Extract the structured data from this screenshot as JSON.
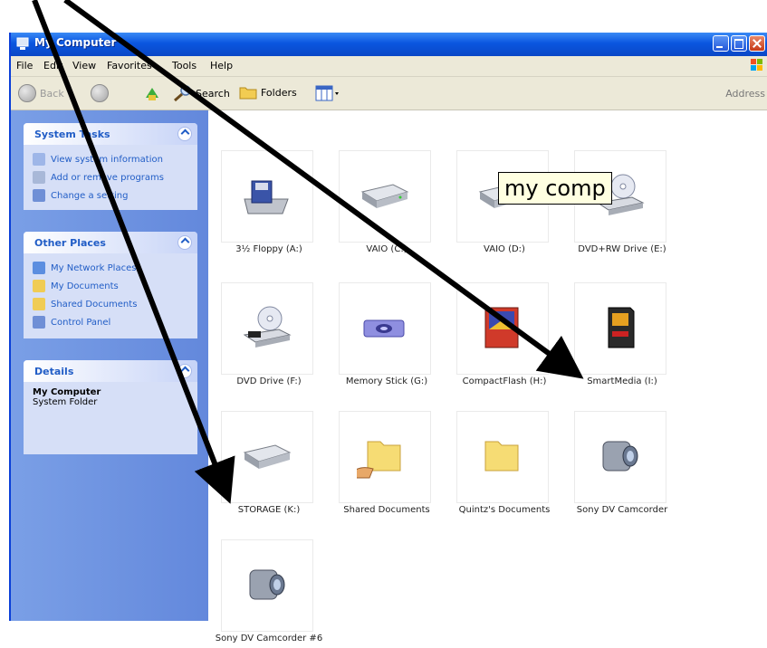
{
  "window": {
    "title": "My Computer",
    "menu": [
      "File",
      "Edit",
      "View",
      "Favorites",
      "Tools",
      "Help"
    ]
  },
  "toolbar": {
    "back_label": "Back",
    "search_label": "Search",
    "folders_label": "Folders",
    "address_label": "Address"
  },
  "sidebar": {
    "system_tasks": {
      "title": "System Tasks",
      "items": [
        "View system information",
        "Add or remove programs",
        "Change a setting"
      ]
    },
    "other_places": {
      "title": "Other Places",
      "items": [
        "My Network Places",
        "My Documents",
        "Shared Documents",
        "Control Panel"
      ]
    },
    "details": {
      "title": "Details",
      "name": "My Computer",
      "subtitle": "System Folder"
    }
  },
  "items": [
    {
      "label": "3½ Floppy (A:)",
      "icon": "floppy-drive-icon"
    },
    {
      "label": "VAIO (C:)",
      "icon": "hard-drive-icon"
    },
    {
      "label": "VAIO (D:)",
      "icon": "hard-drive-icon"
    },
    {
      "label": "DVD+RW Drive (E:)",
      "icon": "dvd-drive-icon"
    },
    {
      "label": "DVD Drive (F:)",
      "icon": "dvd-drive-icon"
    },
    {
      "label": "Memory Stick (G:)",
      "icon": "memory-stick-icon"
    },
    {
      "label": "CompactFlash (H:)",
      "icon": "compactflash-icon"
    },
    {
      "label": "SmartMedia (I:)",
      "icon": "smartmedia-icon"
    },
    {
      "label": "STORAGE (K:)",
      "icon": "hard-drive-icon"
    },
    {
      "label": "Shared Documents",
      "icon": "shared-folder-icon"
    },
    {
      "label": "Quintz's Documents",
      "icon": "folder-icon"
    },
    {
      "label": "Sony DV Camcorder",
      "icon": "camcorder-icon"
    },
    {
      "label": "Sony DV Camcorder #6",
      "icon": "camcorder-icon"
    }
  ],
  "tooltip": {
    "text": "my comp"
  },
  "colors": {
    "titlebar": "#0a56e0",
    "sidebar": "#6d93e1",
    "task_link": "#215dc6",
    "tooltip_bg": "#ffffe1"
  }
}
